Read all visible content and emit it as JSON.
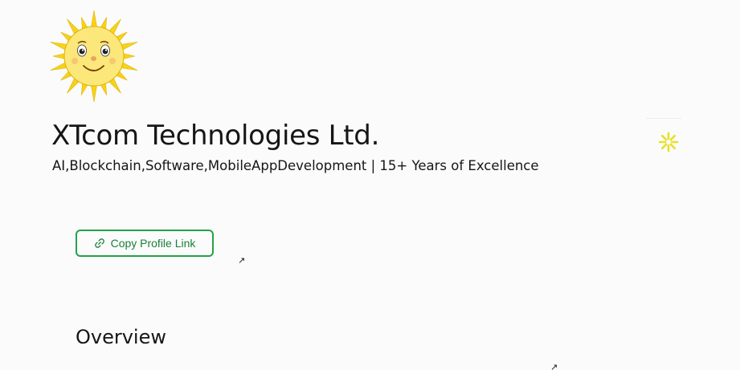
{
  "header": {
    "company_name": "XTcom Technologies Ltd.",
    "tagline": "AI,Blockchain,Software,MobileAppDevelopment | 15+ Years of Excellence"
  },
  "actions": {
    "copy_profile_link_label": "Copy Profile Link",
    "link_icon": "link-icon",
    "external_link_icon": "arrow-up-right-icon",
    "external_arrow_glyph": "↗"
  },
  "sections": {
    "overview_title": "Overview"
  },
  "icons": {
    "logo": "smiling-sun-logo",
    "loading": "loading-spinner-icon"
  },
  "colors": {
    "accent_green": "#24a148",
    "accent_green_text": "#198038",
    "spinner_yellow": "#e8e02a",
    "sun_yellow": "#f7d21a",
    "background": "#fbfbfb",
    "text": "#161616"
  }
}
